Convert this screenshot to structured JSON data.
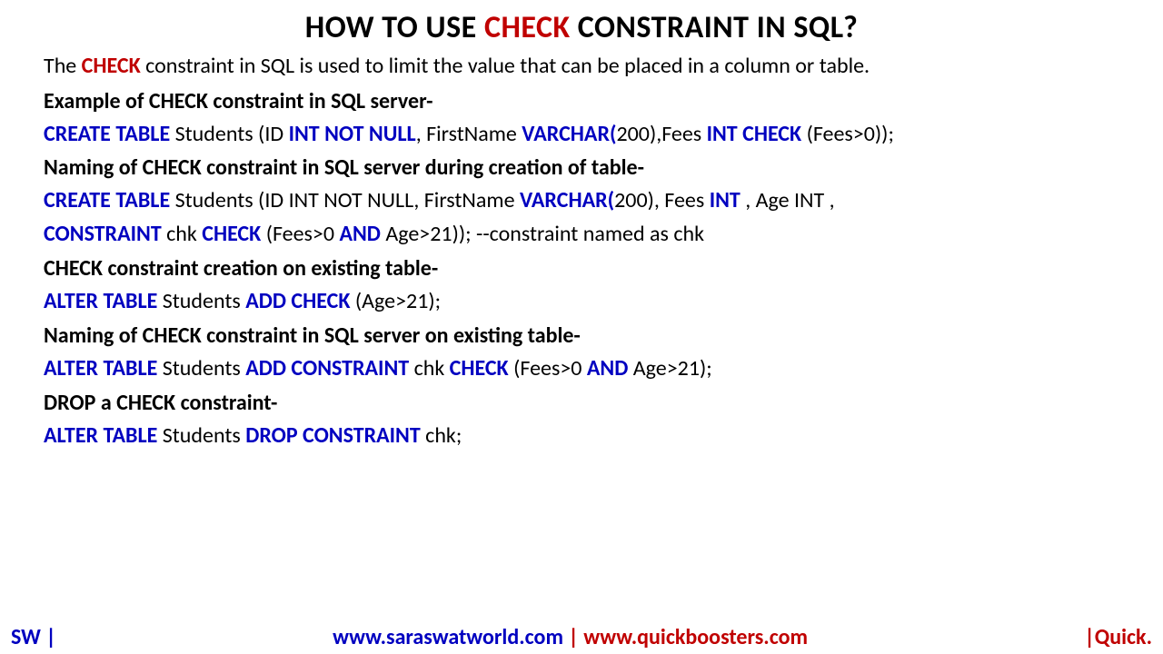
{
  "title": {
    "pre": "HOW TO USE ",
    "highlight": "CHECK",
    "post": " CONSTRAINT IN SQL?"
  },
  "intro": {
    "pre": "The ",
    "keyword": "CHECK",
    "post": " constraint in SQL is used to limit the value that can be placed in a column or table."
  },
  "sections": {
    "s1": "Example of CHECK constraint in SQL server-",
    "s2": "Naming of CHECK constraint in SQL server during creation of table-",
    "s3": "CHECK constraint creation on existing table-",
    "s4": "Naming of CHECK constraint in SQL server on existing table-",
    "s5": "DROP a CHECK constraint-"
  },
  "code": {
    "c1_a": "CREATE TABLE ",
    "c1_b": "Students (ID ",
    "c1_c": "INT NOT NULL",
    "c1_d": ", FirstName ",
    "c1_e": "VARCHAR(",
    "c1_f": "200),Fees ",
    "c1_g": "INT CHECK ",
    "c1_h": "(Fees>0));",
    "c2_a": "CREATE TABLE ",
    "c2_b": "Students (ID INT NOT NULL, FirstName ",
    "c2_c": "VARCHAR(",
    "c2_d": "200), Fees ",
    "c2_e": "INT ",
    "c2_f": ", Age INT ,",
    "c3_a": "CONSTRAINT ",
    "c3_b": "chk ",
    "c3_c": "CHECK ",
    "c3_d": "(Fees>0 ",
    "c3_e": "AND ",
    "c3_f": "Age>21));  --constraint named as chk",
    "c4_a": "ALTER TABLE ",
    "c4_b": "Students ",
    "c4_c": "ADD CHECK ",
    "c4_d": "(Age>21);",
    "c5_a": "ALTER TABLE ",
    "c5_b": "Students ",
    "c5_c": "ADD CONSTRAINT ",
    "c5_d": "chk ",
    "c5_e": "CHECK ",
    "c5_f": "(Fees>0 ",
    "c5_g": "AND ",
    "c5_h": "Age>21);",
    "c6_a": "ALTER TABLE ",
    "c6_b": "Students ",
    "c6_c": "DROP CONSTRAINT ",
    "c6_d": "chk;"
  },
  "footer": {
    "left": "SW |",
    "center_blue": "www.saraswatworld.com ",
    "center_pipe": "| ",
    "center_red": "www.quickboosters.com",
    "right": "|Quick."
  }
}
